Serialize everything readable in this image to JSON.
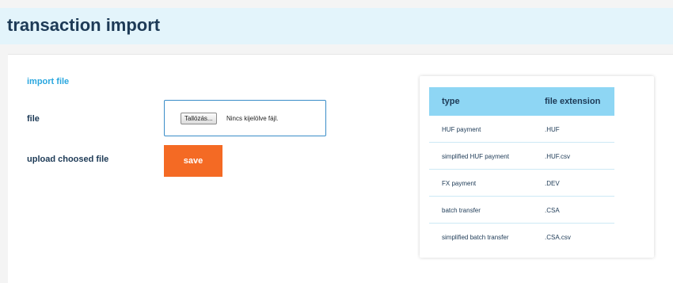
{
  "header": {
    "title": "transaction import"
  },
  "form": {
    "section_title": "import file",
    "file_label": "file",
    "browse_button": "Tallózás...",
    "file_status": "Nincs kijelölve fájl.",
    "upload_label": "upload choosed file",
    "save_button": "save"
  },
  "table": {
    "headers": {
      "type": "type",
      "extension": "file extension"
    },
    "rows": [
      {
        "type": "HUF payment",
        "extension": ".HUF"
      },
      {
        "type": "simplified HUF payment",
        "extension": ".HUF.csv"
      },
      {
        "type": "FX payment",
        "extension": ".DEV"
      },
      {
        "type": "batch transfer",
        "extension": ".CSA"
      },
      {
        "type": "simplified batch transfer",
        "extension": ".CSA.csv"
      }
    ]
  },
  "colors": {
    "accent_orange": "#f46a24",
    "header_bg": "#e3f4fb",
    "table_header_bg": "#8ed6f4",
    "section_title": "#2aa7df",
    "text_dark": "#1d3a56"
  }
}
